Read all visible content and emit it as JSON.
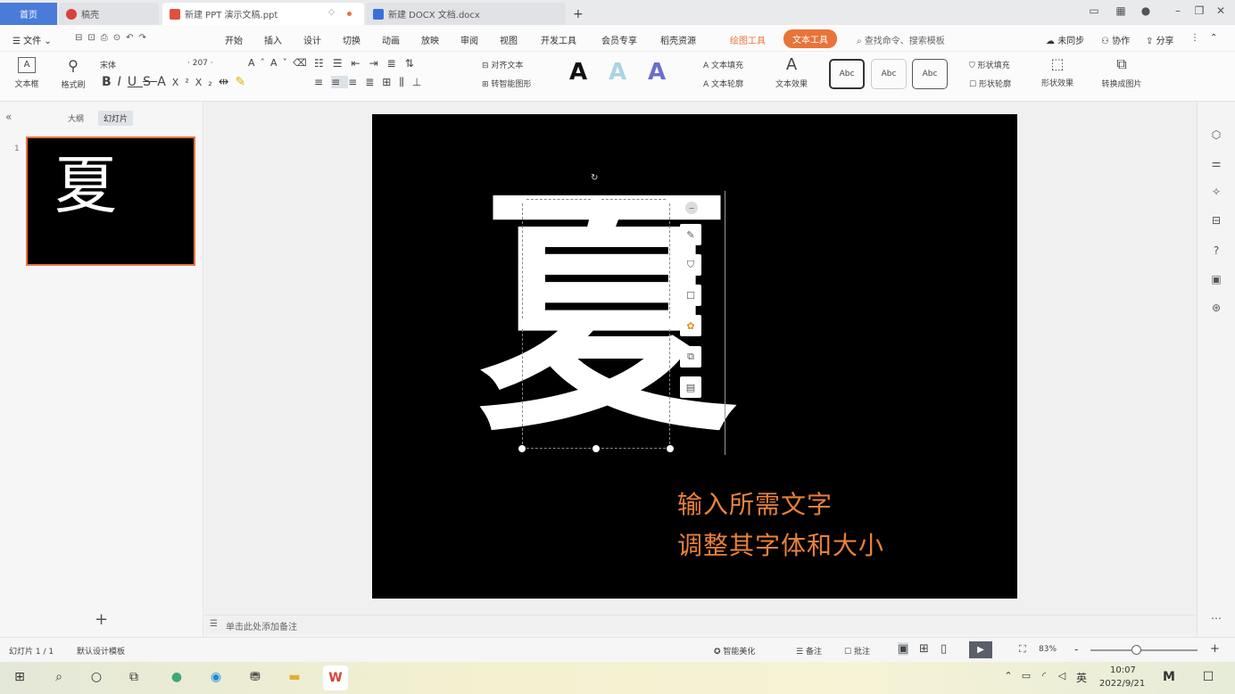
{
  "tabs": {
    "home": "首页",
    "wps": "稿壳",
    "ppt": "新建 PPT 演示文稿.ppt",
    "docx": "新建 DOCX 文档.docx",
    "new_tab": "+"
  },
  "menu": {
    "file": "文件",
    "items": [
      "开始",
      "插入",
      "设计",
      "切换",
      "动画",
      "放映",
      "审阅",
      "视图",
      "开发工具",
      "会员专享",
      "稻壳资源",
      "绘图工具"
    ],
    "text_tool": "文本工具",
    "search": "查找命令、搜索模板",
    "sync": "未同步",
    "collab": "协作",
    "share": "分享"
  },
  "ribbon": {
    "textbox": "文本框",
    "format_painter": "格式刷",
    "font_name": "宋体",
    "font_size": "207",
    "align_text": "对齐文本",
    "convert_smartart": "转智能图形",
    "text_fill": "文本填充",
    "text_outline": "文本轮廓",
    "text_effect": "文本效果",
    "shape_fill": "形状填充",
    "shape_outline": "形状轮廓",
    "shape_effect": "形状效果",
    "shape_to_image": "转换成图片",
    "style_sample": "Abc",
    "wordart_a": "A"
  },
  "left_panel": {
    "outline_tab": "大纲",
    "slides_tab": "幻灯片",
    "slide_number": "1",
    "thumb_char": "夏",
    "add": "+"
  },
  "slide": {
    "main_char": "夏",
    "caption_line1": "输入所需文字",
    "caption_line2": "调整其字体和大小"
  },
  "notes": {
    "placeholder": "单击此处添加备注"
  },
  "status": {
    "slide_count": "幻灯片 1 / 1",
    "template": "默认设计模板",
    "smart_beautify": "智能美化",
    "notes": "备注",
    "comments": "批注",
    "zoom": "83%",
    "zoom_minus": "-",
    "zoom_plus": "+"
  },
  "taskbar": {
    "lang": "英",
    "time": "10:07",
    "date": "2022/9/21"
  },
  "colors": {
    "accent_orange": "#e8743a",
    "caption_orange": "#e8813b",
    "slide_bg": "#000000",
    "tab_active_bg": "#ffffff"
  }
}
